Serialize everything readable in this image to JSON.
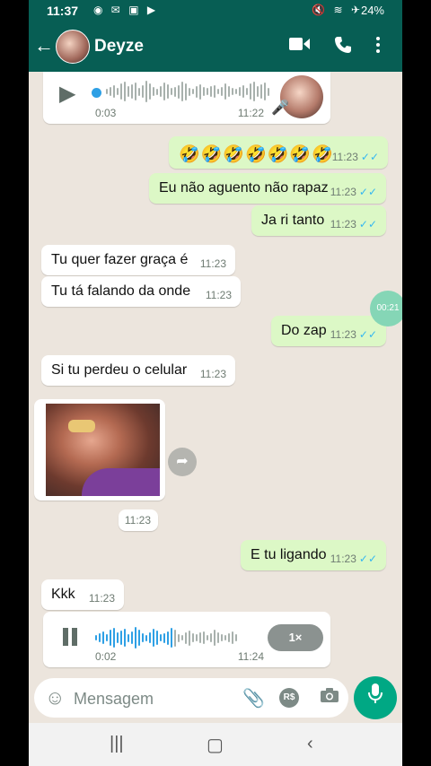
{
  "status_bar": {
    "time": "11:37",
    "left_icons": "◉ ✉ ▣ ▶",
    "right_icons": "🔇 ≋ ✈",
    "battery": "24%"
  },
  "header": {
    "contact_name": "Deyze",
    "icons": [
      "back-arrow-icon",
      "video-call-icon",
      "phone-icon",
      "more-vert-icon"
    ]
  },
  "messages": [
    {
      "type": "audio",
      "direction": "in",
      "duration": "0:03",
      "time": "11:22",
      "progress": 0
    },
    {
      "type": "text",
      "direction": "out",
      "text": "🤣🤣🤣🤣🤣🤣🤣",
      "time": "11:23",
      "read": true
    },
    {
      "type": "text",
      "direction": "out",
      "text": "Eu não aguento não rapaz",
      "time": "11:23",
      "read": true
    },
    {
      "type": "text",
      "direction": "out",
      "text": "Ja ri tanto",
      "time": "11:23",
      "read": true
    },
    {
      "type": "text",
      "direction": "in",
      "text": "Tu quer fazer graça é",
      "time": "11:23"
    },
    {
      "type": "text",
      "direction": "in",
      "text": "Tu tá falando da onde",
      "time": "11:23"
    },
    {
      "type": "text",
      "direction": "out",
      "text": "Do zap",
      "time": "11:23",
      "read": true
    },
    {
      "type": "text",
      "direction": "in",
      "text": "Si tu perdeu o celular",
      "time": "11:23"
    },
    {
      "type": "image",
      "direction": "in",
      "time": "11:23"
    },
    {
      "type": "text",
      "direction": "out",
      "text": "E tu ligando",
      "time": "11:23",
      "read": true
    },
    {
      "type": "text",
      "direction": "in",
      "text": "Kkk",
      "time": "11:23"
    },
    {
      "type": "audio",
      "direction": "in",
      "duration": "0:02",
      "time": "11:24",
      "progress": 0.55,
      "speed": "1×",
      "playing": true
    }
  ],
  "floating_timer": "00:21",
  "composer": {
    "placeholder": "Mensagem",
    "currency_label": "R$"
  },
  "colors": {
    "header": "#075e54",
    "outgoing_bubble": "#dcf8c6",
    "incoming_bubble": "#ffffff",
    "chat_background": "#ece5dd",
    "read_ticks": "#34b7f1",
    "mic_button": "#00a884"
  }
}
